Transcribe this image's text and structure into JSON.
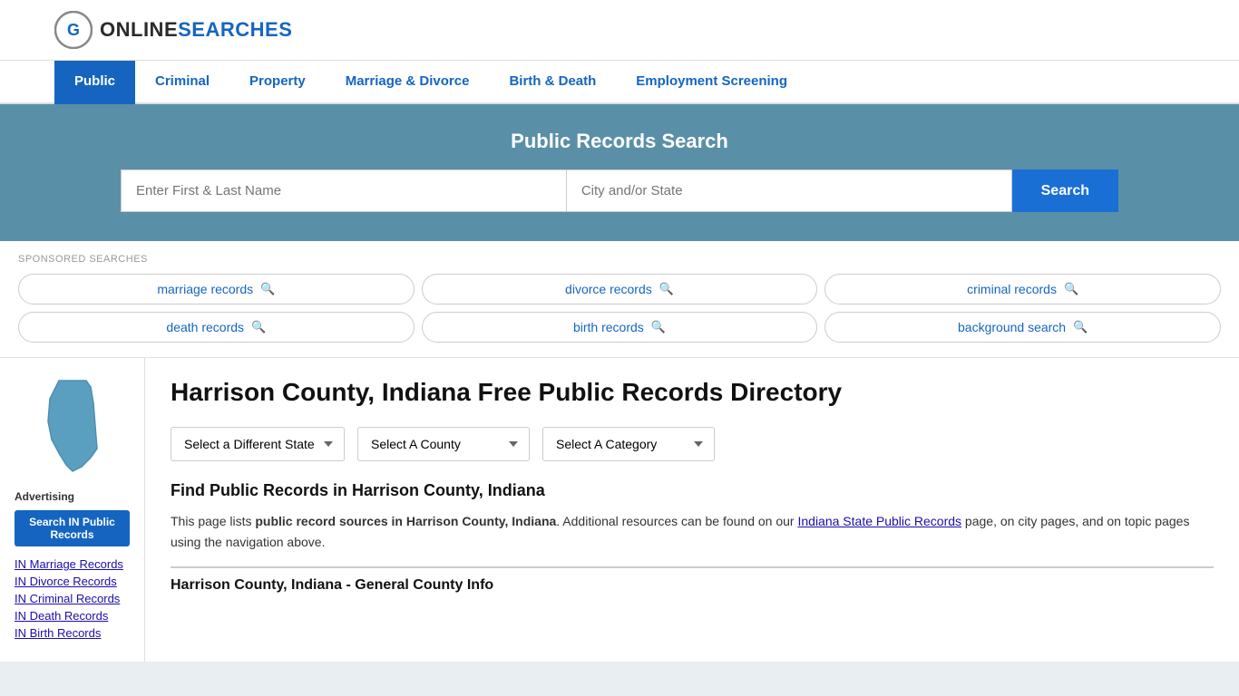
{
  "logo": {
    "online": "ONLINE",
    "searches": "SEARCHES"
  },
  "nav": {
    "items": [
      {
        "label": "Public",
        "active": true
      },
      {
        "label": "Criminal",
        "active": false
      },
      {
        "label": "Property",
        "active": false
      },
      {
        "label": "Marriage & Divorce",
        "active": false
      },
      {
        "label": "Birth & Death",
        "active": false
      },
      {
        "label": "Employment Screening",
        "active": false
      }
    ]
  },
  "search_banner": {
    "title": "Public Records Search",
    "name_placeholder": "Enter First & Last Name",
    "city_placeholder": "City and/or State",
    "button_label": "Search"
  },
  "sponsored": {
    "label": "SPONSORED SEARCHES",
    "items": [
      "marriage records",
      "divorce records",
      "criminal records",
      "death records",
      "birth records",
      "background search"
    ]
  },
  "page": {
    "title": "Harrison County, Indiana Free Public Records Directory",
    "dropdowns": {
      "state": "Select a Different State",
      "county": "Select A County",
      "category": "Select A Category"
    },
    "find_heading": "Find Public Records in Harrison County, Indiana",
    "description_part1": "This page lists ",
    "description_bold": "public record sources in Harrison County, Indiana",
    "description_part2": ". Additional resources can be found on our ",
    "description_link": "Indiana State Public Records",
    "description_part3": " page, on city pages, and on topic pages using the navigation above.",
    "general_info_heading": "Harrison County, Indiana - General County Info"
  },
  "sidebar": {
    "advertising_label": "Advertising",
    "ad_button": "Search IN Public Records",
    "links": [
      "IN Marriage Records",
      "IN Divorce Records",
      "IN Criminal Records",
      "IN Death Records",
      "IN Birth Records"
    ]
  },
  "colors": {
    "nav_active_bg": "#1565c0",
    "banner_bg": "#5a8fa8",
    "search_button": "#1a6fd4",
    "link_color": "#1a0dab",
    "sidebar_ad_bg": "#1565c0"
  }
}
